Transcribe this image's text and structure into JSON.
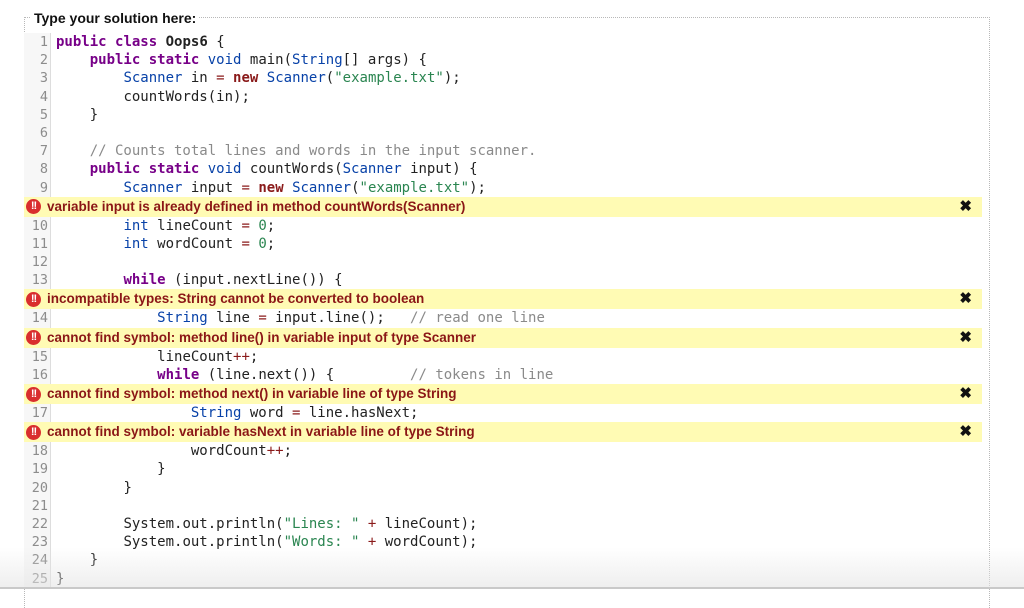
{
  "panel": {
    "legend": "Type your solution here:"
  },
  "code_lines": {
    "l1": {
      "num": "1"
    },
    "l2": {
      "num": "2"
    },
    "l3": {
      "num": "3"
    },
    "l4": {
      "num": "4"
    },
    "l5": {
      "num": "5"
    },
    "l6": {
      "num": "6"
    },
    "l7": {
      "num": "7"
    },
    "l8": {
      "num": "8"
    },
    "l9": {
      "num": "9"
    },
    "l10": {
      "num": "10"
    },
    "l11": {
      "num": "11"
    },
    "l12": {
      "num": "12"
    },
    "l13": {
      "num": "13"
    },
    "l14": {
      "num": "14"
    },
    "l15": {
      "num": "15"
    },
    "l16": {
      "num": "16"
    },
    "l17": {
      "num": "17"
    },
    "l18": {
      "num": "18"
    },
    "l19": {
      "num": "19"
    },
    "l20": {
      "num": "20"
    },
    "l21": {
      "num": "21"
    },
    "l22": {
      "num": "22"
    },
    "l23": {
      "num": "23"
    },
    "l24": {
      "num": "24"
    },
    "l25": {
      "num": "25"
    }
  },
  "tokens": {
    "public": "public",
    "class": "class",
    "static": "static",
    "void": "void",
    "new": "new",
    "int": "int",
    "while": "while",
    "String": "String",
    "Scanner": "Scanner",
    "className": "Oops6",
    "open": " {",
    "l2_rest_a": " main(",
    "l2_rest_b": "[] args) {",
    "l3_in": " in ",
    "eq": "=",
    "l3_paren": "(",
    "str_example": "\"example.txt\"",
    "l3_end": ");",
    "l4": "countWords(in);",
    "close": "}",
    "l7": "// Counts total lines and words in the input scanner.",
    "l8_name": " countWords(",
    "l8_end": " input) {",
    "l9_input": " input ",
    "l10_a": " lineCount ",
    "l11_a": " wordCount ",
    "zero": "0",
    "semi": ";",
    "l13_a": " (input.nextLine()) {",
    "l14_a": " line ",
    "l14_b": " input.line();   ",
    "l14_cm": "// read one line",
    "l15_a": "lineCount",
    "pp": "++",
    "l16_a": " (line.next()) {         ",
    "l16_cm": "// tokens in line",
    "l17_a": " word ",
    "l17_b": " line.hasNext;",
    "l18_a": "wordCount",
    "l22_a": "System.out.println(",
    "str_lines": "\"Lines: \"",
    "plus": "+",
    "l22_b": " lineCount);",
    "str_words": "\"Words: \"",
    "l23_b": " wordCount);"
  },
  "errors": [
    {
      "message": "variable input is already defined in method countWords(Scanner)",
      "icon": "error-icon",
      "close": "✖"
    },
    {
      "message": "incompatible types: String cannot be converted to boolean",
      "icon": "error-icon",
      "close": "✖"
    },
    {
      "message": "cannot find symbol: method line() in variable input of type Scanner",
      "icon": "error-icon",
      "close": "✖"
    },
    {
      "message": "cannot find symbol: method next() in variable line of type String",
      "icon": "error-icon",
      "close": "✖"
    },
    {
      "message": "cannot find symbol: variable hasNext in variable line of type String",
      "icon": "error-icon",
      "close": "✖"
    }
  ],
  "error_icon_glyph": "!!",
  "colors": {
    "error_bg": "#fffbb4",
    "error_text": "#8b1616",
    "error_icon": "#d92e2e",
    "keyword": "#770088",
    "type": "#0842a8",
    "string": "#2a8550",
    "comment": "#8a8a8a"
  }
}
